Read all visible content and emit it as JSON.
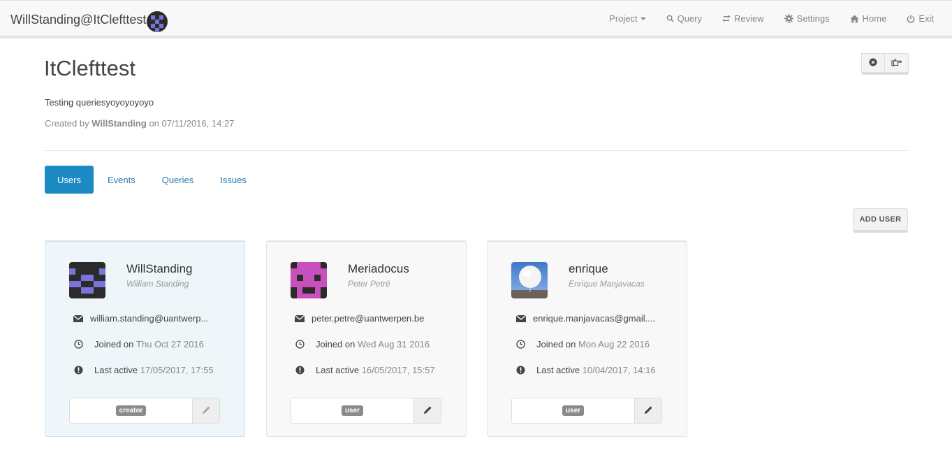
{
  "navbar": {
    "brand": "WillStanding@ItClefttest",
    "items": [
      {
        "label": "Project",
        "icon": "caret-down-icon"
      },
      {
        "label": "Query",
        "icon": "search-icon"
      },
      {
        "label": "Review",
        "icon": "retweet-icon"
      },
      {
        "label": "Settings",
        "icon": "gear-icon"
      },
      {
        "label": "Home",
        "icon": "home-icon"
      },
      {
        "label": "Exit",
        "icon": "power-icon"
      }
    ]
  },
  "project": {
    "title": "ItClefttest",
    "description": "Testing queriesyoyoyoyoyo",
    "created_prefix": "Created by",
    "created_by": "WillStanding",
    "created_on_prefix": "on",
    "created_on": "07/11/2016, 14:27"
  },
  "tabs": [
    {
      "label": "Users",
      "active": true
    },
    {
      "label": "Events",
      "active": false
    },
    {
      "label": "Queries",
      "active": false
    },
    {
      "label": "Issues",
      "active": false
    }
  ],
  "add_user_label": "ADD USER",
  "labels": {
    "joined": "Joined on",
    "last_active": "Last active"
  },
  "users": [
    {
      "username": "WillStanding",
      "fullname": "William Standing",
      "email": "william.standing@uantwerp...",
      "joined": "Thu Oct 27 2016",
      "last_active": "17/05/2017, 17:55",
      "role": "creator",
      "avatar_color": "#7a74d8"
    },
    {
      "username": "Meriadocus",
      "fullname": "Peter Petré",
      "email": "peter.petre@uantwerpen.be",
      "joined": "Wed Aug 31 2016",
      "last_active": "16/05/2017, 15:57",
      "role": "user",
      "avatar_color": "#c94fbd"
    },
    {
      "username": "enrique",
      "fullname": "Enrique Manjavacas",
      "email": "enrique.manjavacas@gmail....",
      "joined": "Mon Aug 22 2016",
      "last_active": "10/04/2017, 14:16",
      "role": "user",
      "avatar_color": "#5b8fd1"
    }
  ]
}
